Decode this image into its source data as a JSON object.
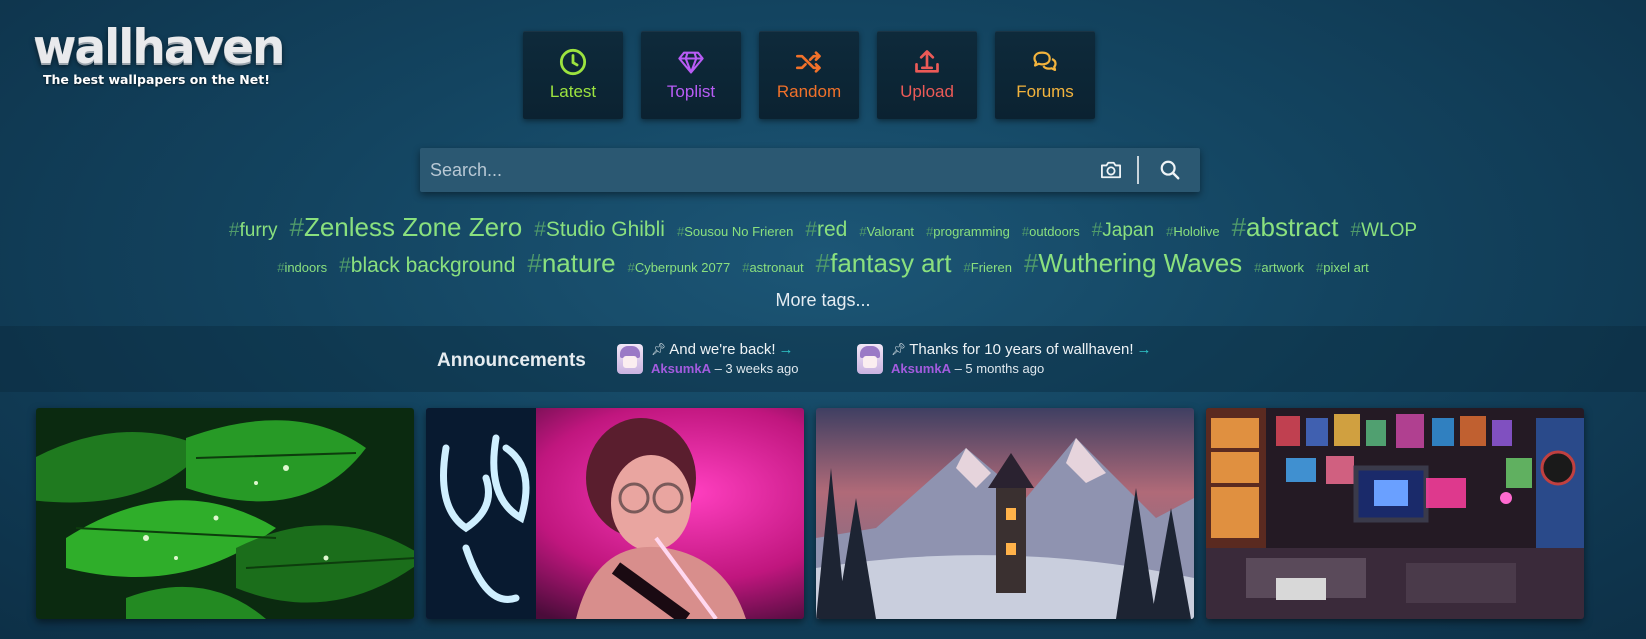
{
  "logo": {
    "word": "wallhaven",
    "tagline": "The best wallpapers on the Net!"
  },
  "nav": [
    {
      "label": "Latest",
      "color": "#9ce33f",
      "icon": "clock-icon"
    },
    {
      "label": "Toplist",
      "color": "#b85cf5",
      "icon": "diamond-icon"
    },
    {
      "label": "Random",
      "color": "#f0712a",
      "icon": "shuffle-icon"
    },
    {
      "label": "Upload",
      "color": "#ec5a57",
      "icon": "upload-icon"
    },
    {
      "label": "Forums",
      "color": "#f2b33d",
      "icon": "chat-bubbles-icon"
    }
  ],
  "search": {
    "placeholder": "Search...",
    "camera_icon": "camera-icon",
    "search_icon": "search-icon"
  },
  "tags_row1": [
    {
      "name": "furry",
      "size": "medium"
    },
    {
      "name": "Zenless Zone Zero",
      "size": "xl"
    },
    {
      "name": "Studio Ghibli",
      "size": "large"
    },
    {
      "name": "Sousou No Frieren",
      "size": "small"
    },
    {
      "name": "red",
      "size": "large"
    },
    {
      "name": "Valorant",
      "size": "small"
    },
    {
      "name": "programming",
      "size": "small"
    },
    {
      "name": "outdoors",
      "size": "small"
    },
    {
      "name": "Japan",
      "size": "medium"
    },
    {
      "name": "Hololive",
      "size": "small"
    },
    {
      "name": "abstract",
      "size": "xl"
    },
    {
      "name": "WLOP",
      "size": "medium"
    }
  ],
  "tags_row2": [
    {
      "name": "indoors",
      "size": "small"
    },
    {
      "name": "black background",
      "size": "large"
    },
    {
      "name": "nature",
      "size": "xl"
    },
    {
      "name": "Cyberpunk 2077",
      "size": "small"
    },
    {
      "name": "astronaut",
      "size": "small"
    },
    {
      "name": "fantasy art",
      "size": "xl"
    },
    {
      "name": "Frieren",
      "size": "small"
    },
    {
      "name": "Wuthering Waves",
      "size": "xl"
    },
    {
      "name": "artwork",
      "size": "small"
    },
    {
      "name": "pixel art",
      "size": "small"
    }
  ],
  "more_tags": "More tags...",
  "announcements": {
    "title": "Announcements",
    "items": [
      {
        "text": "And we're back!",
        "author": "AksumkA",
        "time": "– 3 weeks ago"
      },
      {
        "text": "Thanks for 10 years of wallhaven!",
        "author": "AksumkA",
        "time": "– 5 months ago"
      }
    ]
  },
  "thumbnails": [
    {
      "subject": "green-leaves-raindrops"
    },
    {
      "subject": "girl-pink-neon"
    },
    {
      "subject": "snowy-tower-mountains"
    },
    {
      "subject": "retro-gaming-room"
    }
  ],
  "colors": {
    "tag": "#8ae07e",
    "tag_hash": "#4f9a6a",
    "author": "#a35bdf",
    "arrow": "#2fc7c9"
  }
}
